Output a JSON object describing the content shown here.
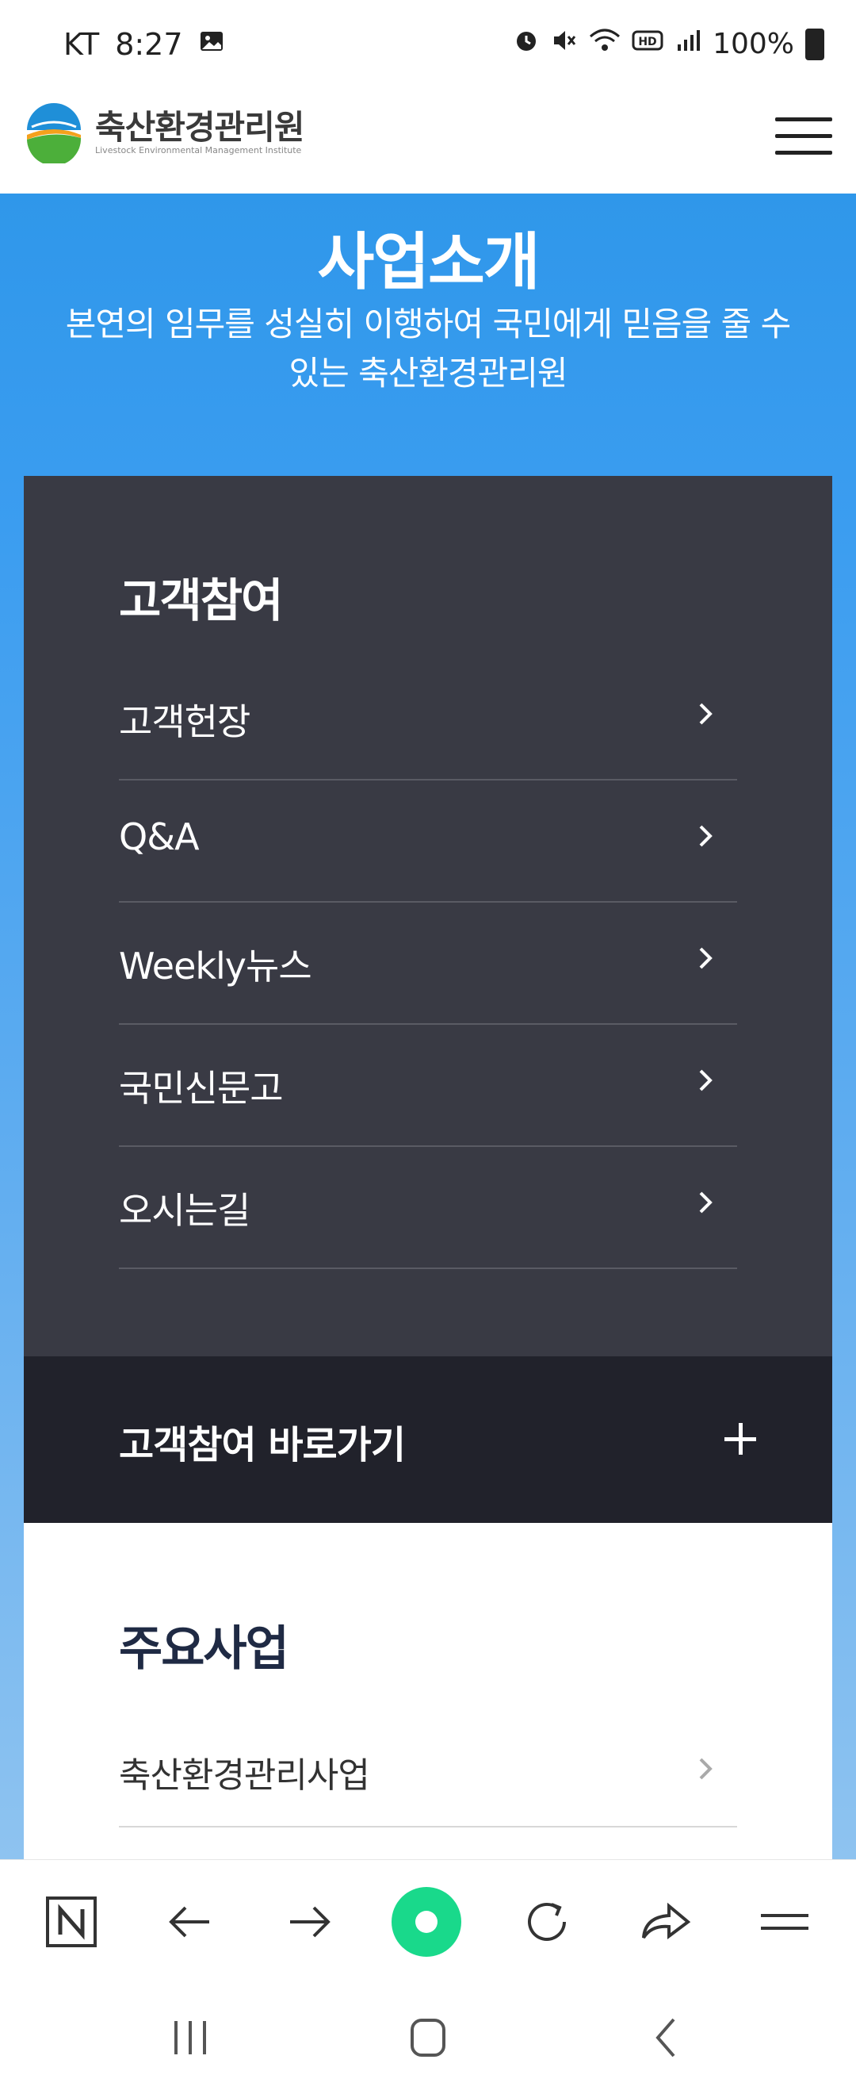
{
  "status_bar": {
    "carrier": "KT",
    "time": "8:27",
    "battery": "100%",
    "icons": [
      "image-icon",
      "alarm-icon",
      "mute-icon",
      "wifi-icon",
      "hd-icon",
      "signal-icon",
      "battery-icon"
    ]
  },
  "header": {
    "logo_text": "축산환경관리원",
    "logo_sub": "Livestock Environmental Management Institute",
    "menu_icon": "hamburger-icon"
  },
  "hero": {
    "title": "사업소개",
    "subtitle": "본연의 임무를 성실히 이행하여 국민에게 믿음을 줄 수 있는 축산환경관리원"
  },
  "panel": {
    "title": "고객참여",
    "items": [
      {
        "label": "고객헌장"
      },
      {
        "label": "Q&A"
      },
      {
        "label": "Weekly뉴스"
      },
      {
        "label": "국민신문고"
      },
      {
        "label": "오시는길"
      }
    ],
    "shortcut_label": "고객참여 바로가기"
  },
  "main_business": {
    "title": "주요사업",
    "items": [
      {
        "label": "축산환경관리사업"
      }
    ]
  },
  "colors": {
    "hero_blue": "#3b9df0",
    "panel_dark": "#393a44",
    "shortcut_dark": "#21222b",
    "accent_green": "#19d98b"
  },
  "toolbar": {
    "icons": [
      "naver-icon",
      "back-arrow-icon",
      "forward-arrow-icon",
      "green-dot-icon",
      "reload-icon",
      "share-icon",
      "menu-icon"
    ]
  },
  "system_nav": {
    "icons": [
      "recent-apps-icon",
      "home-icon",
      "back-icon"
    ]
  }
}
